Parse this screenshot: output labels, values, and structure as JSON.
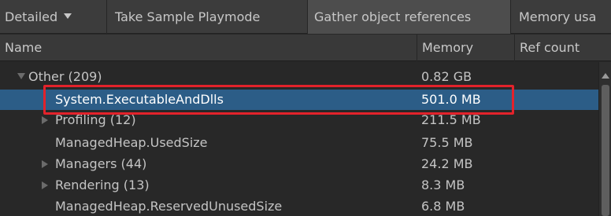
{
  "toolbar": {
    "view_mode": "Detailed",
    "take_sample": "Take Sample Playmode",
    "gather_refs": "Gather object references",
    "memory_usage": "Memory usa"
  },
  "columns": {
    "name": "Name",
    "memory": "Memory",
    "ref_count": "Ref count"
  },
  "rows": [
    {
      "name": "Other (209)",
      "memory": "0.82 GB"
    },
    {
      "name": "System.ExecutableAndDlls",
      "memory": "501.0 MB"
    },
    {
      "name": "Profiling (12)",
      "memory": "211.5 MB"
    },
    {
      "name": "ManagedHeap.UsedSize",
      "memory": "75.5 MB"
    },
    {
      "name": "Managers (44)",
      "memory": "24.2 MB"
    },
    {
      "name": "Rendering (13)",
      "memory": "8.3 MB"
    },
    {
      "name": "ManagedHeap.ReservedUnusedSize",
      "memory": "6.8 MB"
    }
  ],
  "colors": {
    "selection": "#2c5d87",
    "highlight_border": "#e3222b"
  },
  "icons": [
    "dropdown-caret-icon",
    "tree-expanded-icon",
    "tree-collapsed-icon",
    "scroll-up-icon"
  ]
}
